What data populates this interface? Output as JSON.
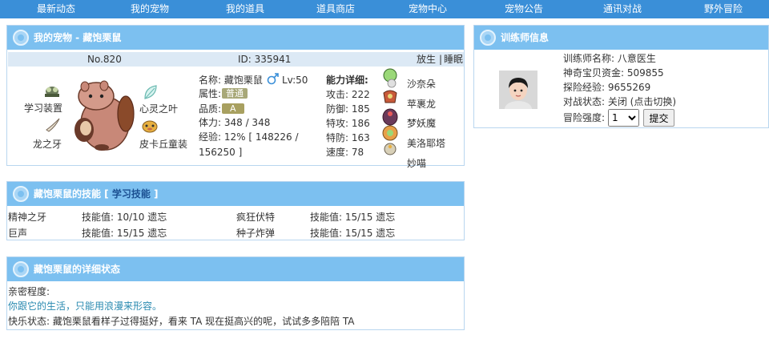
{
  "nav": [
    "最新动态",
    "我的宠物",
    "我的道具",
    "道具商店",
    "宠物中心",
    "宠物公告",
    "通讯对战",
    "野外冒险"
  ],
  "pet": {
    "header": "我的宠物 - 藏饱栗鼠",
    "number": "No.820",
    "id_text": "ID: 335941",
    "release": "放生",
    "separator": "|",
    "sleep": "睡眠",
    "equip_slots": [
      {
        "label": "学习装置",
        "icon": "exp-share-icon"
      },
      {
        "label": "龙之牙",
        "icon": "dragon-fang-icon"
      },
      {
        "label": "心灵之叶",
        "icon": "leaf-icon"
      },
      {
        "label": "皮卡丘童装",
        "icon": "pikachu-costume-icon"
      }
    ],
    "info": {
      "name_label": "名称: 藏饱栗鼠",
      "level": "Lv:50",
      "type_label": "属性:",
      "type_value": "普通",
      "grade_label": "品质:",
      "grade_value": "A",
      "hp": "体力: 348 / 348",
      "exp_line1": "经验: 12% [ 148226 /",
      "exp_line2": "156250 ]"
    },
    "stats": {
      "title": "能力详细:",
      "attack": "攻击: 222",
      "defense": "防御: 185",
      "sp_attack": "特攻: 186",
      "sp_defense": "特防: 163",
      "speed": "速度: 78"
    },
    "party": [
      "沙奈朵",
      "苹裹龙",
      "梦妖魔",
      "美洛耶塔",
      "妙喵"
    ]
  },
  "skills": {
    "header_prefix": "藏饱栗鼠的技能 [ ",
    "learn": "学习技能",
    "header_suffix": " ]",
    "rows": [
      {
        "name": "精神之牙",
        "value": "技能值: 10/10 遗忘"
      },
      {
        "name": "疯狂伏特",
        "value": "技能值: 15/15 遗忘"
      },
      {
        "name": "巨声",
        "value": "技能值: 15/15 遗忘"
      },
      {
        "name": "种子炸弹",
        "value": "技能值: 15/15 遗忘"
      }
    ]
  },
  "status": {
    "header": "藏饱栗鼠的详细状态",
    "intimacy_label": "亲密程度:",
    "intimacy_text": "你跟它的生活，只能用浪漫来形容。",
    "happiness": "快乐状态: 藏饱栗鼠看样子过得挺好，看来 TA 现在挺高兴的呢，试试多多陪陪 TA"
  },
  "trainer": {
    "header": "训练师信息",
    "name": "训练师名称: 八意医生",
    "money": "神奇宝贝资金: 509855",
    "exp": "探险经验: 9655269",
    "battle": "对战状态: 关闭  (点击切换)",
    "difficulty_label": "冒险强度:",
    "difficulty_value": "1",
    "submit": "提交"
  }
}
